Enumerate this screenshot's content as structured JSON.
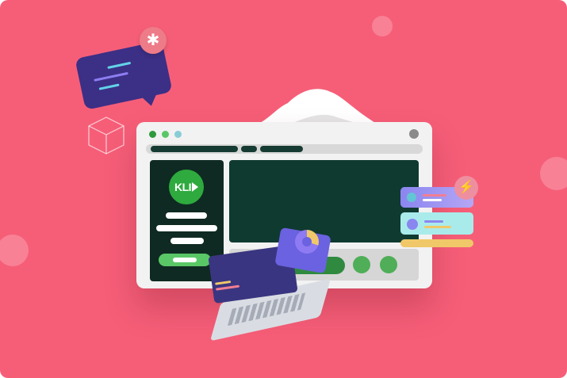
{
  "logo": {
    "text": "KLI"
  },
  "colors": {
    "background": "#f65e78",
    "dark_green": "#0f2a22",
    "accent_green": "#2faa3e",
    "laptop_purple": "#3a3580",
    "chat_purple": "#3c2f86"
  },
  "icons": {
    "gear": "gear-icon",
    "bolt": "lightning-icon",
    "cube": "cube-icon",
    "pin": "map-pin-icon",
    "play": "play-icon"
  },
  "glyphs": {
    "gear": "✱",
    "bolt": "⚡"
  }
}
